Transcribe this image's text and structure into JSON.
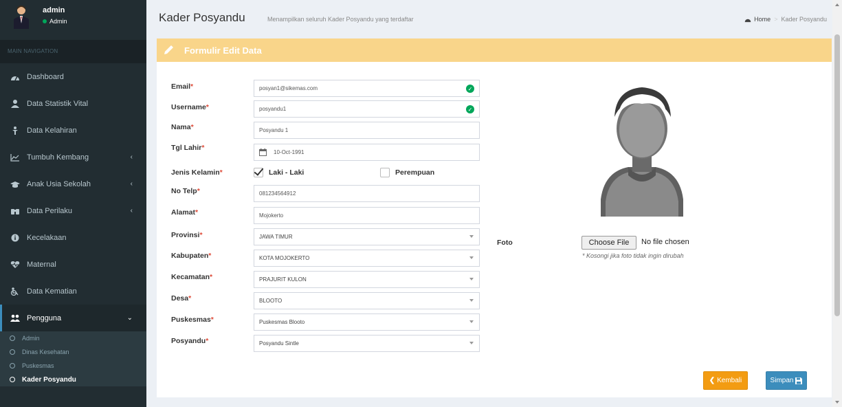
{
  "user": {
    "name": "admin",
    "role": "Admin"
  },
  "nav": {
    "header": "MAIN NAVIGATION",
    "items": [
      {
        "label": "Dashboard",
        "icon": "dashboard-icon"
      },
      {
        "label": "Data Statistik Vital",
        "icon": "user-icon"
      },
      {
        "label": "Data Kelahiran",
        "icon": "child-icon"
      },
      {
        "label": "Tumbuh Kembang",
        "icon": "line-chart-icon"
      },
      {
        "label": "Anak Usia Sekolah",
        "icon": "mortarboard-icon"
      },
      {
        "label": "Data Perilaku",
        "icon": "binoculars-icon"
      },
      {
        "label": "Kecelakaan",
        "icon": "info-circle-icon"
      },
      {
        "label": "Maternal",
        "icon": "heartbeat-icon"
      },
      {
        "label": "Data Kematian",
        "icon": "wheelchair-icon"
      },
      {
        "label": "Pengguna",
        "icon": "users-icon"
      }
    ],
    "sub": [
      "Admin",
      "Dinas Kesehatan",
      "Puskesmas",
      "Kader Posyandu"
    ]
  },
  "page": {
    "title": "Kader Posyandu",
    "subtitle": "Menampilkan seluruh Kader Posyandu yang terdaftar"
  },
  "breadcrumb": {
    "home": "Home",
    "current": "Kader Posyandu"
  },
  "form": {
    "title": "Formulir Edit Data",
    "labels": {
      "email": "Email",
      "username": "Username",
      "nama": "Nama",
      "tgl": "Tgl Lahir",
      "jk": "Jenis Kelamin",
      "telp": "No Telp",
      "alamat": "Alamat",
      "provinsi": "Provinsi",
      "kabupaten": "Kabupaten",
      "kecamatan": "Kecamatan",
      "desa": "Desa",
      "puskesmas": "Puskesmas",
      "posyandu": "Posyandu",
      "foto": "Foto"
    },
    "values": {
      "email": "posyan1@sikemas.com",
      "username": "posyandu1",
      "nama": "Posyandu 1",
      "tgl": "10-Oct-1991",
      "telp": "081234564912",
      "alamat": "Mojokerto",
      "provinsi": "JAWA TIMUR",
      "kabupaten": "KOTA MOJOKERTO",
      "kecamatan": "PRAJURIT KULON",
      "desa": "BLOOTO",
      "puskesmas": "Puskesmas Blooto",
      "posyandu": "Posyandu Sintle"
    },
    "gender": {
      "male": "Laki - Laki",
      "female": "Perempuan",
      "selected": "male"
    },
    "required_mark": "*",
    "file": {
      "button": "Choose File",
      "status": "No file chosen",
      "hint": "* Kosongi jika foto tidak ingin dirubah"
    },
    "buttons": {
      "back": "Kembali",
      "save": "Simpan"
    }
  },
  "colors": {
    "sidebar": "#222d32",
    "header": "#f9d58a",
    "warning": "#f39c12",
    "primary": "#3c8dbc",
    "success": "#00a65a"
  }
}
